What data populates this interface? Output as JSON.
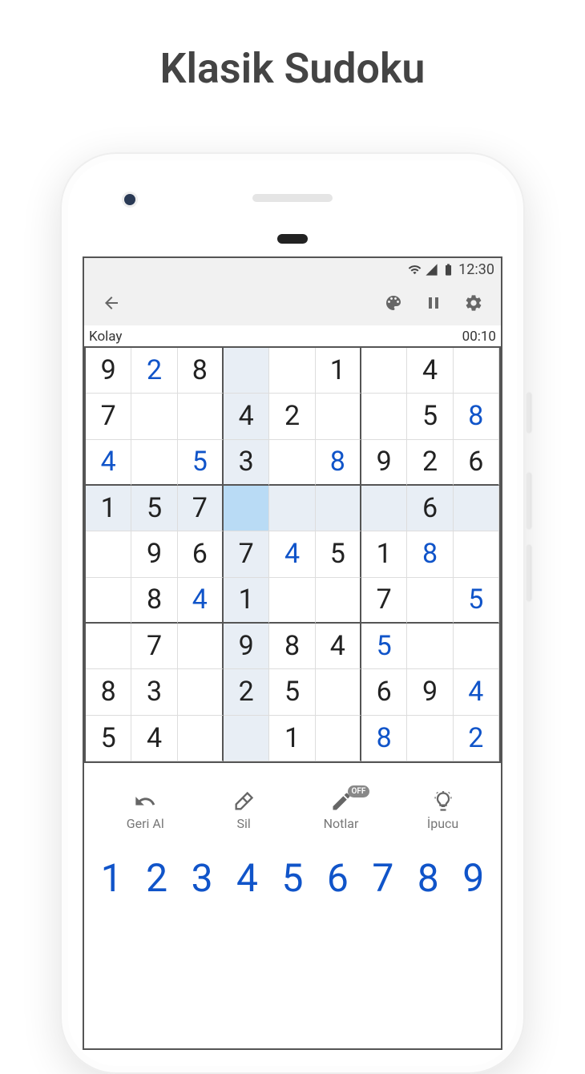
{
  "page_title": "Klasik Sudoku",
  "status": {
    "time": "12:30"
  },
  "info": {
    "difficulty": "Kolay",
    "timer": "00:10"
  },
  "board": {
    "selected": [
      3,
      3
    ],
    "rows": [
      [
        {
          "v": "9"
        },
        {
          "v": "2",
          "u": true
        },
        {
          "v": "8"
        },
        {
          "v": ""
        },
        {
          "v": ""
        },
        {
          "v": "1"
        },
        {
          "v": ""
        },
        {
          "v": "4"
        },
        {
          "v": ""
        }
      ],
      [
        {
          "v": "7"
        },
        {
          "v": ""
        },
        {
          "v": ""
        },
        {
          "v": "4"
        },
        {
          "v": "2"
        },
        {
          "v": ""
        },
        {
          "v": ""
        },
        {
          "v": "5"
        },
        {
          "v": "8",
          "u": true
        }
      ],
      [
        {
          "v": "4",
          "u": true
        },
        {
          "v": ""
        },
        {
          "v": "5",
          "u": true
        },
        {
          "v": "3"
        },
        {
          "v": ""
        },
        {
          "v": "8",
          "u": true
        },
        {
          "v": "9"
        },
        {
          "v": "2"
        },
        {
          "v": "6"
        }
      ],
      [
        {
          "v": "1"
        },
        {
          "v": "5"
        },
        {
          "v": "7"
        },
        {
          "v": ""
        },
        {
          "v": ""
        },
        {
          "v": ""
        },
        {
          "v": ""
        },
        {
          "v": "6"
        },
        {
          "v": ""
        }
      ],
      [
        {
          "v": ""
        },
        {
          "v": "9"
        },
        {
          "v": "6"
        },
        {
          "v": "7"
        },
        {
          "v": "4",
          "u": true
        },
        {
          "v": "5"
        },
        {
          "v": "1"
        },
        {
          "v": "8",
          "u": true
        },
        {
          "v": ""
        }
      ],
      [
        {
          "v": ""
        },
        {
          "v": "8"
        },
        {
          "v": "4",
          "u": true
        },
        {
          "v": "1"
        },
        {
          "v": ""
        },
        {
          "v": ""
        },
        {
          "v": "7"
        },
        {
          "v": ""
        },
        {
          "v": "5",
          "u": true
        }
      ],
      [
        {
          "v": ""
        },
        {
          "v": "7"
        },
        {
          "v": ""
        },
        {
          "v": "9"
        },
        {
          "v": "8"
        },
        {
          "v": "4"
        },
        {
          "v": "5",
          "u": true
        },
        {
          "v": ""
        },
        {
          "v": ""
        }
      ],
      [
        {
          "v": "8"
        },
        {
          "v": "3"
        },
        {
          "v": ""
        },
        {
          "v": "2"
        },
        {
          "v": "5"
        },
        {
          "v": ""
        },
        {
          "v": "6"
        },
        {
          "v": "9"
        },
        {
          "v": "4",
          "u": true
        }
      ],
      [
        {
          "v": "5"
        },
        {
          "v": "4"
        },
        {
          "v": ""
        },
        {
          "v": ""
        },
        {
          "v": "1"
        },
        {
          "v": ""
        },
        {
          "v": "8",
          "u": true
        },
        {
          "v": ""
        },
        {
          "v": "2",
          "u": true
        }
      ]
    ]
  },
  "actions": {
    "undo": "Geri Al",
    "erase": "Sil",
    "notes": "Notlar",
    "notes_state": "OFF",
    "hint": "İpucu"
  },
  "numpad": [
    "1",
    "2",
    "3",
    "4",
    "5",
    "6",
    "7",
    "8",
    "9"
  ]
}
